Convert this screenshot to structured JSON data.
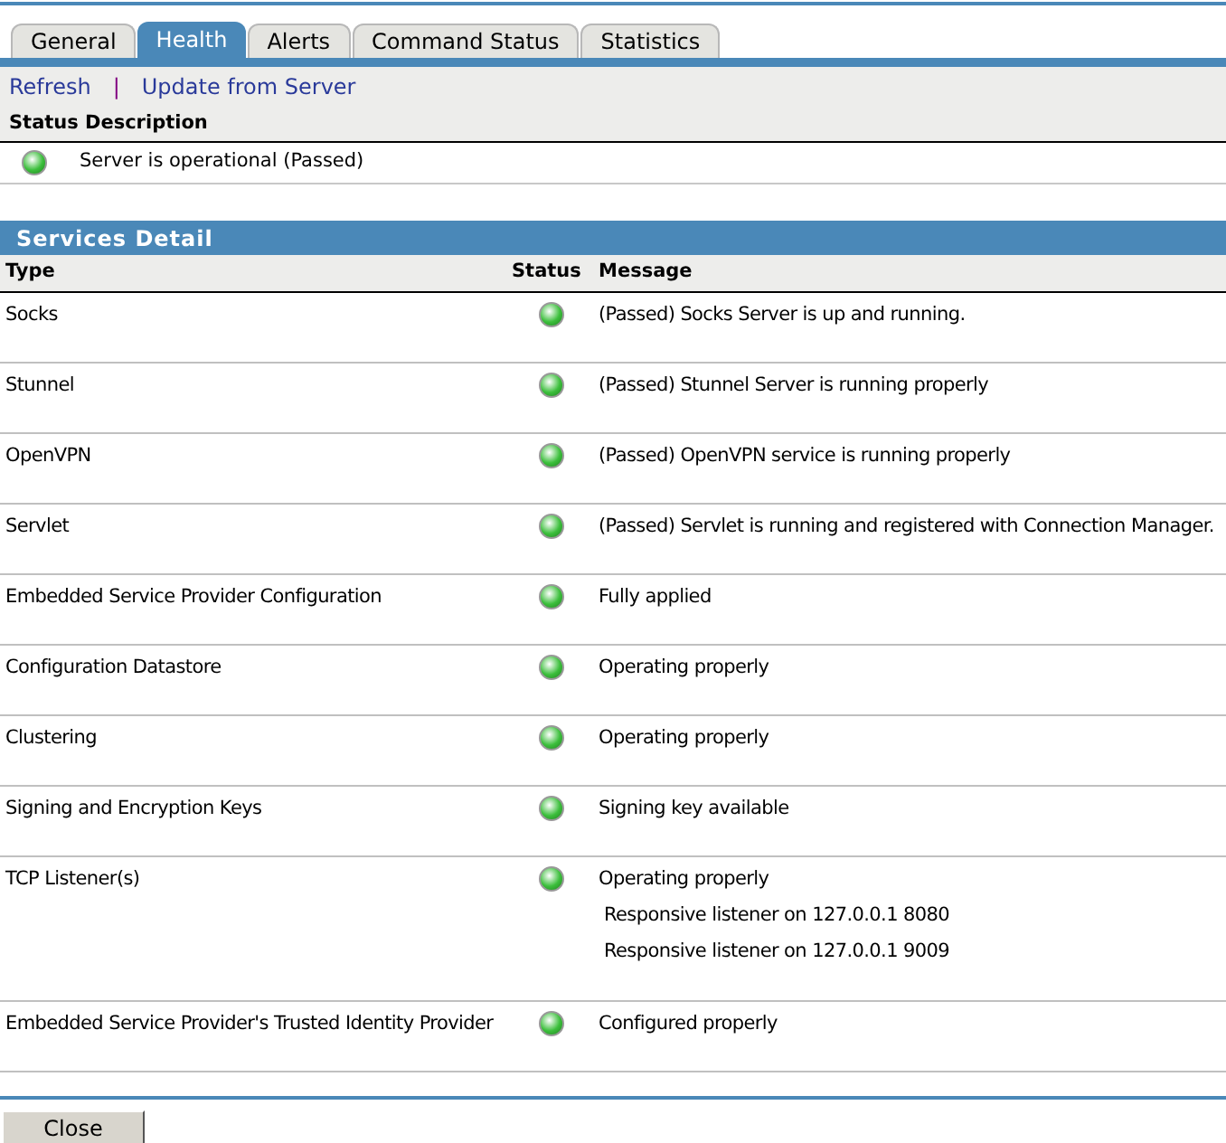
{
  "tabs": [
    {
      "label": "General",
      "selected": false
    },
    {
      "label": "Health",
      "selected": true
    },
    {
      "label": "Alerts",
      "selected": false
    },
    {
      "label": "Command Status",
      "selected": false
    },
    {
      "label": "Statistics",
      "selected": false
    }
  ],
  "toolbar": {
    "links": [
      "Refresh",
      "Update from Server"
    ],
    "separator": "|"
  },
  "health_table": {
    "columns": [
      "Status",
      "Description"
    ],
    "rows": [
      {
        "passed": true,
        "description": "Server is operational (Passed)"
      }
    ]
  },
  "services_detail": {
    "title": "Services Detail",
    "columns": [
      "Type",
      "Status",
      "Message"
    ],
    "rows": [
      {
        "type": "Socks",
        "passed": true,
        "message": "(Passed) Socks Server is up and running."
      },
      {
        "type": "Stunnel",
        "passed": true,
        "message": "(Passed) Stunnel Server is running properly"
      },
      {
        "type": "OpenVPN",
        "passed": true,
        "message": "(Passed) OpenVPN service is running properly"
      },
      {
        "type": "Servlet",
        "passed": true,
        "message": "(Passed) Servlet is running and registered with Connection Manager."
      },
      {
        "type": "Embedded Service Provider Configuration",
        "passed": true,
        "message": "Fully applied"
      },
      {
        "type": "Configuration Datastore",
        "passed": true,
        "message": "Operating properly"
      },
      {
        "type": "Clustering",
        "passed": true,
        "message": "Operating properly"
      },
      {
        "type": "Signing and Encryption Keys",
        "passed": true,
        "message": "Signing key available"
      },
      {
        "type": "TCP Listener(s)",
        "passed": true,
        "message": "Operating properly",
        "details": [
          "Responsive listener on 127.0.0.1 8080",
          "Responsive listener on 127.0.0.1 9009"
        ]
      },
      {
        "type": "Embedded Service Provider's Trusted Identity Provider",
        "passed": true,
        "message": "Configured properly"
      }
    ]
  },
  "buttons": [
    "Close"
  ]
}
